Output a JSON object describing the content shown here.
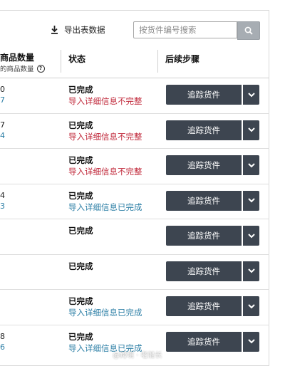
{
  "toolbar": {
    "export_label": "导出表数据",
    "search_placeholder": "按货件编号搜索"
  },
  "header": {
    "qty_title": "商品数量",
    "qty_subtitle": "的商品数量",
    "status_title": "状态",
    "next_steps_title": "后续步骤"
  },
  "rows": [
    {
      "qty_top": "0",
      "qty_bottom": "7",
      "status": "已完成",
      "detail": "导入详细信息不完整",
      "detail_color": "#c0283a",
      "track_label": "追踪货件"
    },
    {
      "qty_top": "7",
      "qty_bottom": "4",
      "status": "已完成",
      "detail": "导入详细信息不完整",
      "detail_color": "#c0283a",
      "track_label": "追踪货件"
    },
    {
      "qty_top": "",
      "qty_bottom": "",
      "status": "已完成",
      "detail": "导入详细信息不完整",
      "detail_color": "#c0283a",
      "track_label": "追踪货件"
    },
    {
      "qty_top": "4",
      "qty_bottom": "3",
      "status": "已完成",
      "detail": "导入详细信息已完成",
      "detail_color": "#2d7fa6",
      "track_label": "追踪货件"
    },
    {
      "qty_top": "",
      "qty_bottom": "",
      "status": "已完成",
      "detail": "",
      "detail_color": "#2d7fa6",
      "track_label": "追踪货件"
    },
    {
      "qty_top": "",
      "qty_bottom": "",
      "status": "已完成",
      "detail": "",
      "detail_color": "#2d7fa6",
      "track_label": "追踪货件"
    },
    {
      "qty_top": "",
      "qty_bottom": "",
      "status": "已完成",
      "detail": "导入详细信息已完成",
      "detail_color": "#2d7fa6",
      "track_label": "追踪货件"
    },
    {
      "qty_top": "8",
      "qty_bottom": "6",
      "status": "已完成",
      "detail": "导入详细信息已完成",
      "detail_color": "#2d7fa6",
      "track_label": "追踪货件"
    }
  ],
  "colors": {
    "button_bg": "#3d4550",
    "link_blue": "#2d7fa6",
    "error_red": "#c0283a"
  },
  "icons": {
    "export": "download-icon",
    "search": "search-icon",
    "dropdown": "chevron-down-icon",
    "help": "help-circle-icon"
  },
  "watermark": "@跨境 · 老船长"
}
